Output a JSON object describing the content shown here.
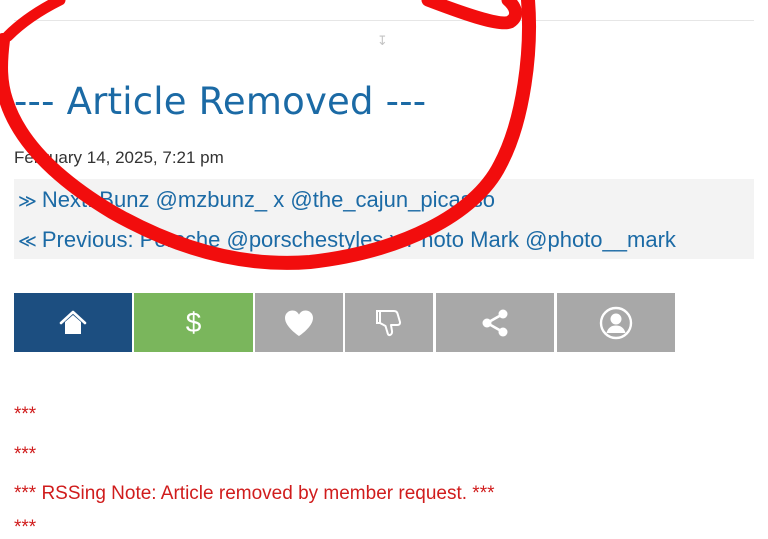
{
  "article": {
    "title": "--- Article Removed ---",
    "date": "February 14, 2025, 7:21 pm",
    "next": {
      "arrow": "≫",
      "label": "Next: Bunz @mzbunz_ x @the_cajun_picasso"
    },
    "previous": {
      "arrow": "≪",
      "label": "Previous: Porsche @porschestyles x Photo Mark @photo__mark"
    }
  },
  "action_bar": {
    "buttons": [
      {
        "name": "home",
        "icon": "home-icon",
        "color": "#1c4e80"
      },
      {
        "name": "donate",
        "icon": "dollar-icon",
        "glyph": "$",
        "color": "#7ab65c"
      },
      {
        "name": "like",
        "icon": "heart-icon",
        "color": "#a8a8a8"
      },
      {
        "name": "dislike",
        "icon": "thumbs-down-icon",
        "color": "#a8a8a8"
      },
      {
        "name": "share",
        "icon": "share-icon",
        "color": "#a8a8a8"
      },
      {
        "name": "profile",
        "icon": "user-icon",
        "color": "#a8a8a8"
      }
    ]
  },
  "notice": {
    "lines": [
      "***",
      "***",
      "*** RSSing Note: Article removed by member request. ***",
      "***"
    ],
    "color": "#d01c1c"
  },
  "colors": {
    "link": "#1b6aa5",
    "annotation_ink": "#f20d0d"
  }
}
